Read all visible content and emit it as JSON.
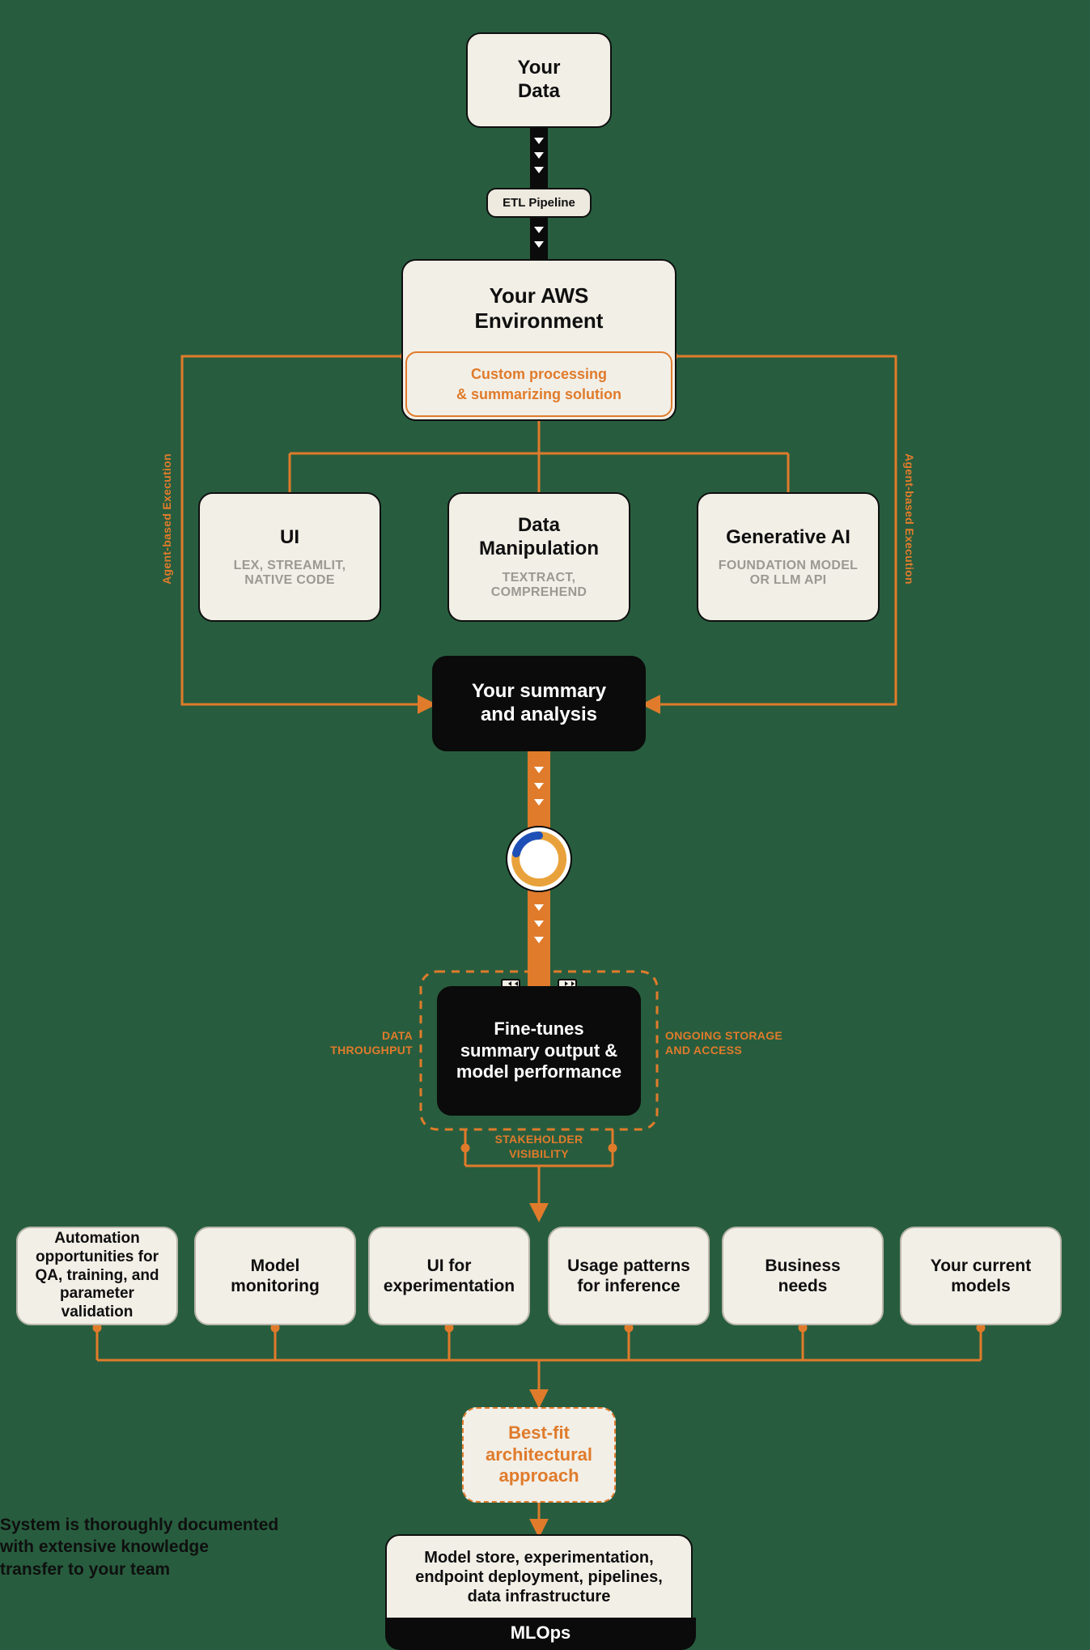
{
  "nodes": {
    "your_data": "Your\nData",
    "etl_pipeline": "ETL Pipeline",
    "aws_env_title": "Your AWS\nEnvironment",
    "aws_env_inner": "Custom processing\n& summarizing solution",
    "ui_title": "UI",
    "ui_sub": "LEX, STREAMLIT,\nNATIVE CODE",
    "data_manip_title": "Data\nManipulation",
    "data_manip_sub": "TEXTRACT,\nCOMPREHEND",
    "genai_title": "Generative AI",
    "genai_sub": "FOUNDATION MODEL\nOR LLM API",
    "summary_analysis": "Your summary\nand analysis",
    "fine_tunes": "Fine-tunes\nsummary output &\nmodel performance",
    "consider": {
      "automation": "Automation\nopportunities for\nQA, training, and\nparameter validation",
      "monitoring": "Model\nmonitoring",
      "ui_exp": "UI for\nexperimentation",
      "usage": "Usage patterns\nfor inference",
      "business": "Business\nneeds",
      "models": "Your current\nmodels"
    },
    "best_fit": "Best-fit\narchitectural\napproach",
    "mlops_body": "Model store, experimentation,\nendpoint deployment, pipelines,\ndata infrastructure",
    "mlops_footer": "MLOps"
  },
  "labels": {
    "agent_left": "Agent-based Execution",
    "agent_right": "Agent-based Execution",
    "data_throughput": "DATA\nTHROUGHPUT",
    "ongoing_storage": "ONGOING STORAGE\nAND ACCESS",
    "stakeholder": "STAKEHOLDER\nVISIBILITY"
  },
  "footnote": "System is thoroughly documented\nwith extensive knowledge\ntransfer to your team"
}
